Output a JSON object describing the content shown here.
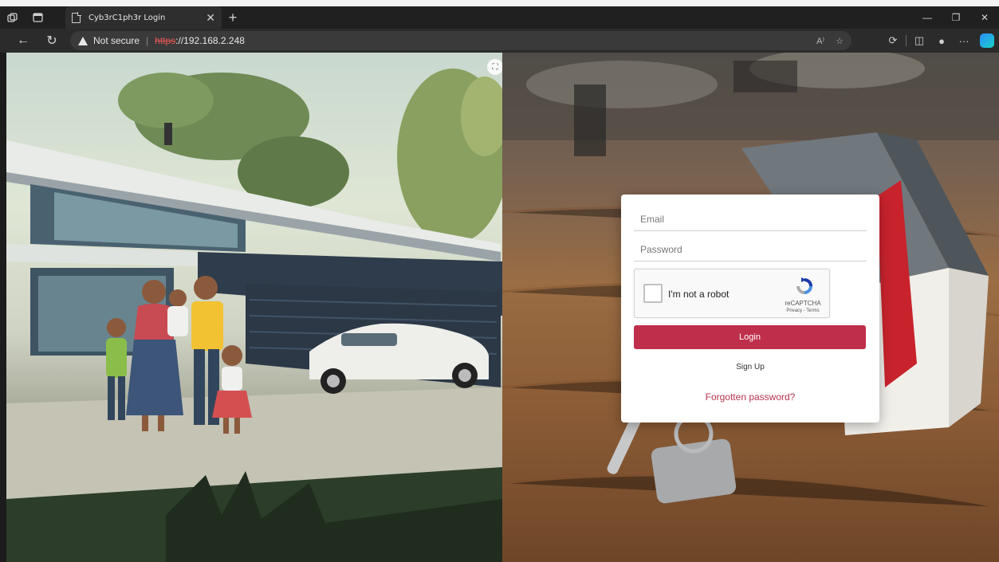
{
  "browser": {
    "tab_title": "Cyb3rC1ph3r Login",
    "security_label": "Not secure",
    "url_scheme": "https",
    "url_rest": "://192.168.2.248"
  },
  "login": {
    "email_placeholder": "Email",
    "password_placeholder": "Password",
    "captcha_label": "I'm not a robot",
    "captcha_brand": "reCAPTCHA",
    "captcha_links": "Privacy - Terms",
    "login_label": "Login",
    "signup_label": "Sign Up",
    "forgot_label": "Forgotten password?"
  },
  "colors": {
    "accent": "#bf2f4b",
    "link": "#b8334f",
    "insecure": "#e35656"
  },
  "icons": {
    "tab": "page-icon",
    "security": "warning-icon",
    "captcha": "recaptcha-icon"
  }
}
